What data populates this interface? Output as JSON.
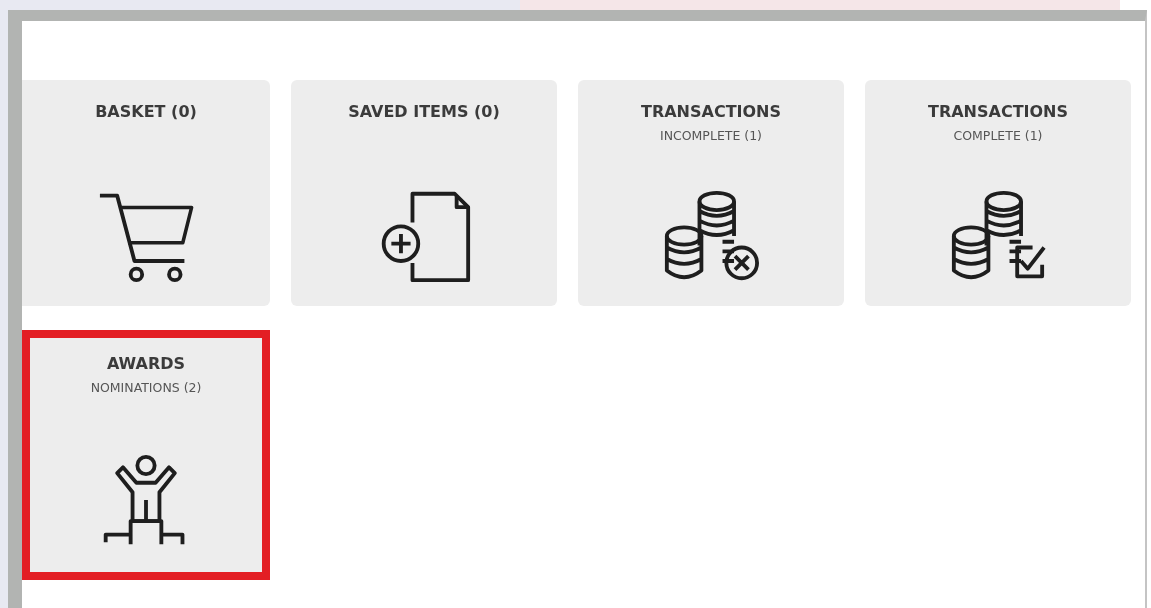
{
  "tiles": [
    {
      "title": "BASKET (0)",
      "kind": "cart",
      "highlighted": false
    },
    {
      "title": "SAVED ITEMS (0)",
      "kind": "document",
      "highlighted": false
    },
    {
      "title": "TRANSACTIONS",
      "subtitle": "INCOMPLETE (1)",
      "kind": "incomplete",
      "highlighted": false
    },
    {
      "title": "TRANSACTIONS",
      "subtitle": "COMPLETE (1)",
      "kind": "complete",
      "highlighted": false
    },
    {
      "title": "AWARDS",
      "subtitle": "NOMINATIONS (2)",
      "kind": "award",
      "highlighted": true
    }
  ]
}
